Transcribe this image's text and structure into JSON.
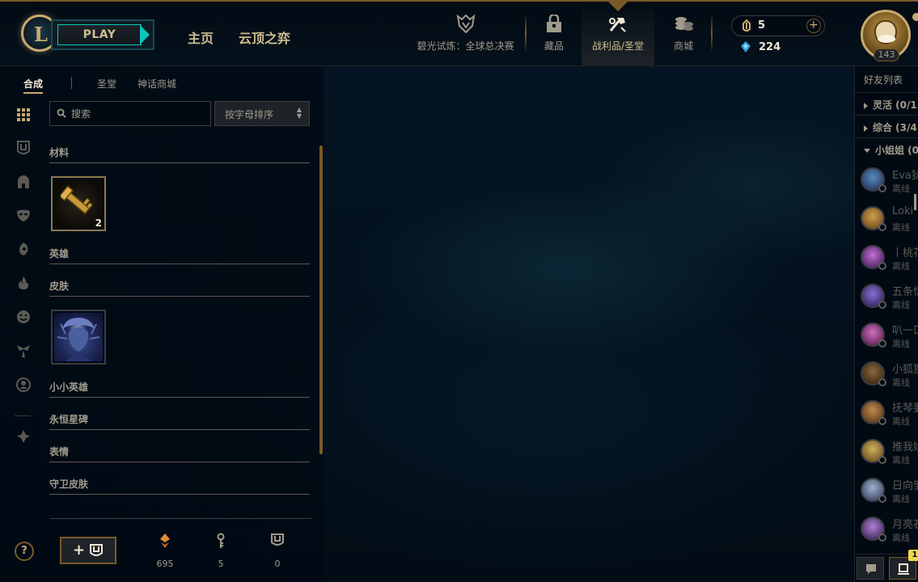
{
  "topbar": {
    "play_label": "PLAY",
    "nav": {
      "home": "主页",
      "tft": "云顶之弈"
    },
    "tabs": {
      "event": "碧光试炼：全球总决赛",
      "collection": "藏品",
      "loot": "战利品/圣堂",
      "store": "商城"
    },
    "currency": {
      "blue_essence": "5",
      "riot_points": "224"
    },
    "profile": {
      "level": "143"
    }
  },
  "loot": {
    "subtabs": {
      "craft": "合成",
      "vault": "圣堂",
      "mythic_shop": "神话商城"
    },
    "search": {
      "placeholder": "搜索"
    },
    "sort": {
      "value": "按字母排序"
    },
    "categories": {
      "materials": "材料",
      "champions": "英雄",
      "skins": "皮肤",
      "little_legends": "小小英雄",
      "eternals": "永恒星碑",
      "emotes": "表情",
      "ward_skins": "守卫皮肤"
    },
    "items": {
      "key_fragment_count": "2"
    },
    "bottom": {
      "help": "?",
      "add_plus": "+",
      "essence": "695",
      "keys": "5",
      "chests": "0"
    }
  },
  "friends": {
    "title": "好友列表",
    "groups": {
      "flex": "灵活 (0/1",
      "general": "综合 (3/4",
      "ladies": "小姐姐 (0"
    },
    "list": [
      {
        "name": "Eva狄",
        "status": "离线"
      },
      {
        "name": "Loki",
        "status": "离线"
      },
      {
        "name": "丨桃花",
        "status": "离线"
      },
      {
        "name": "五条悟",
        "status": "离线"
      },
      {
        "name": "叭一口",
        "status": "离线"
      },
      {
        "name": "小狐狸",
        "status": "离线"
      },
      {
        "name": "抚琴要",
        "status": "离线"
      },
      {
        "name": "推我娃",
        "status": "离线"
      },
      {
        "name": "日向雏",
        "status": "离线"
      },
      {
        "name": "月亮石",
        "status": "离线"
      }
    ],
    "badge": "1"
  },
  "colors": {
    "gold": "#c8aa6e",
    "dark_gold": "#785a28",
    "teal": "#0ac8b9",
    "text": "#a09b8c",
    "background": "#010a13"
  }
}
